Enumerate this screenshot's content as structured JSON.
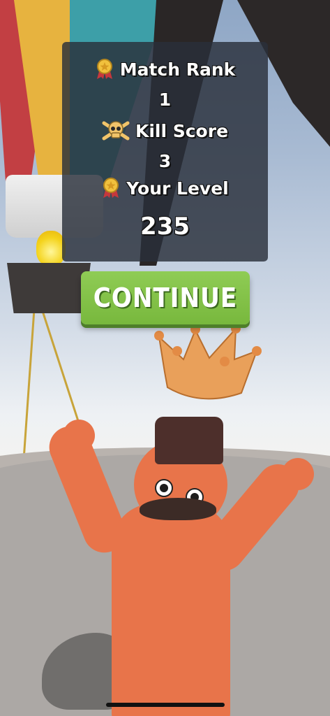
{
  "results": {
    "match_rank_label": "Match Rank",
    "match_rank_value": "1",
    "kill_score_label": "Kill Score",
    "kill_score_value": "3",
    "your_level_label": "Your Level",
    "your_level_value": "235"
  },
  "continue_button": {
    "label": "CONTINUE"
  },
  "colors": {
    "panel": "#2a303a",
    "button": "#86c34d",
    "character": "#e8744a",
    "crown": "#e8a45e"
  },
  "icons": {
    "match_rank": "medal-icon",
    "kill_score": "skull-crossbones-icon",
    "your_level": "medal-icon",
    "crown": "crown-icon"
  }
}
